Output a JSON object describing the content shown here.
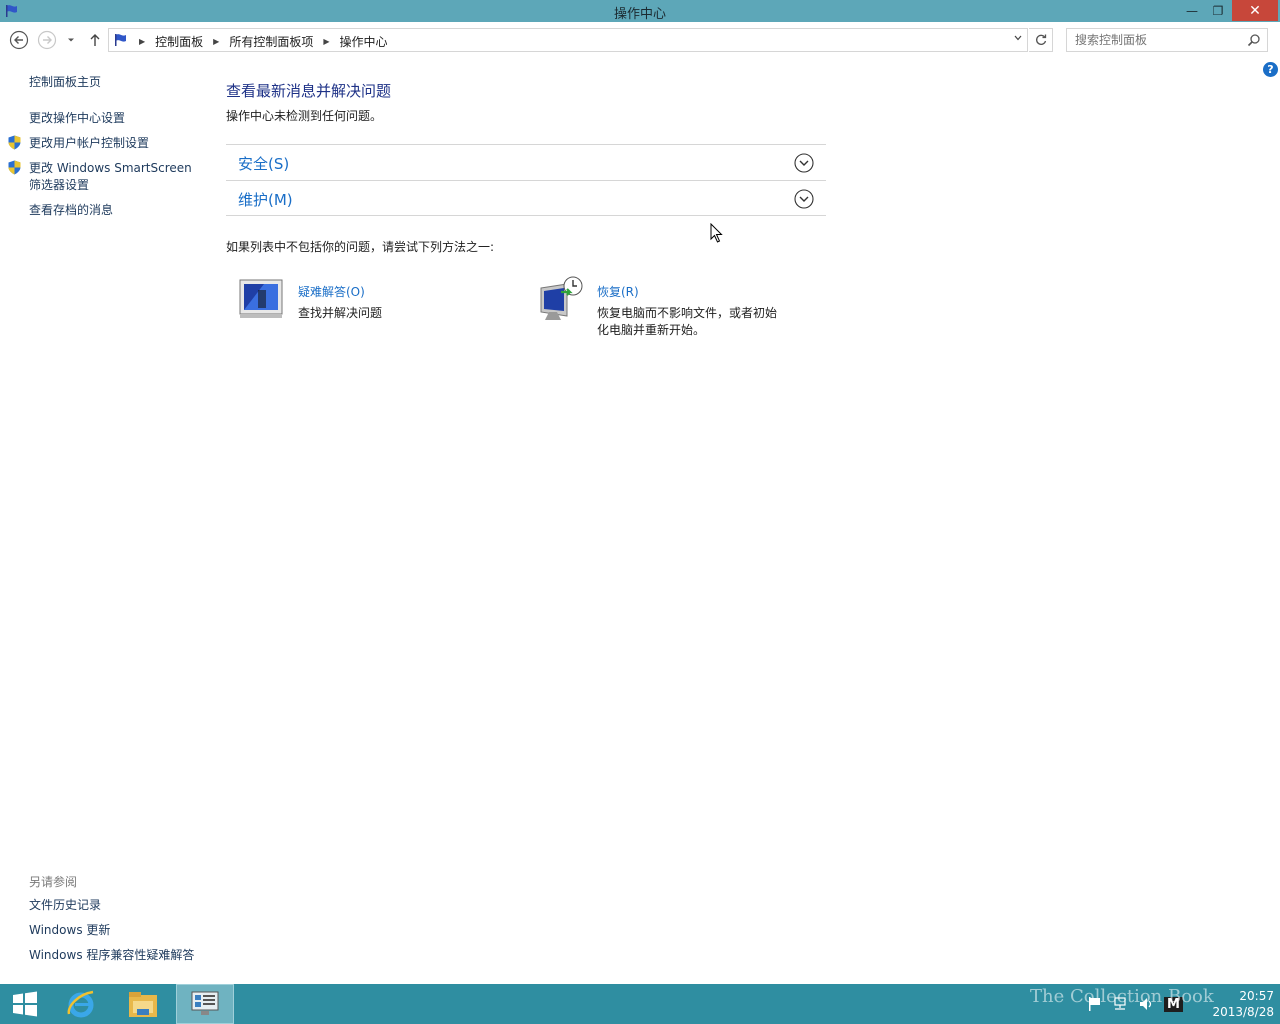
{
  "window": {
    "title": "操作中心",
    "minimize": "—",
    "maximize": "❐",
    "close": "✕"
  },
  "address": {
    "crumbs": [
      "控制面板",
      "所有控制面板项",
      "操作中心"
    ],
    "search_placeholder": "搜索控制面板"
  },
  "sidebar": {
    "home": "控制面板主页",
    "links": [
      "更改操作中心设置",
      "更改用户帐户控制设置",
      "更改 Windows SmartScreen",
      "筛选器设置",
      "查看存档的消息"
    ],
    "see_also_title": "另请参阅",
    "see_also": [
      "文件历史记录",
      "Windows 更新",
      "Windows 程序兼容性疑难解答"
    ]
  },
  "main": {
    "title": "查看最新消息并解决问题",
    "subtitle": "操作中心未检测到任何问题。",
    "sections": [
      "安全(S)",
      "维护(M)"
    ],
    "try_text": "如果列表中不包括你的问题，请尝试下列方法之一:",
    "tools": [
      {
        "link": "疑难解答(O)",
        "desc": "查找并解决问题"
      },
      {
        "link": "恢复(R)",
        "desc": "恢复电脑而不影响文件，或者初始化电脑并重新开始。"
      }
    ]
  },
  "help_label": "?",
  "taskbar": {
    "time": "20:57",
    "date": "2013/8/28",
    "ime": "M",
    "watermark": "The Collection Book"
  },
  "colors": {
    "titlebar": "#5da7b8",
    "taskbar": "#2f8ea1",
    "link": "#1a6ec7",
    "heading": "#1e3287"
  }
}
